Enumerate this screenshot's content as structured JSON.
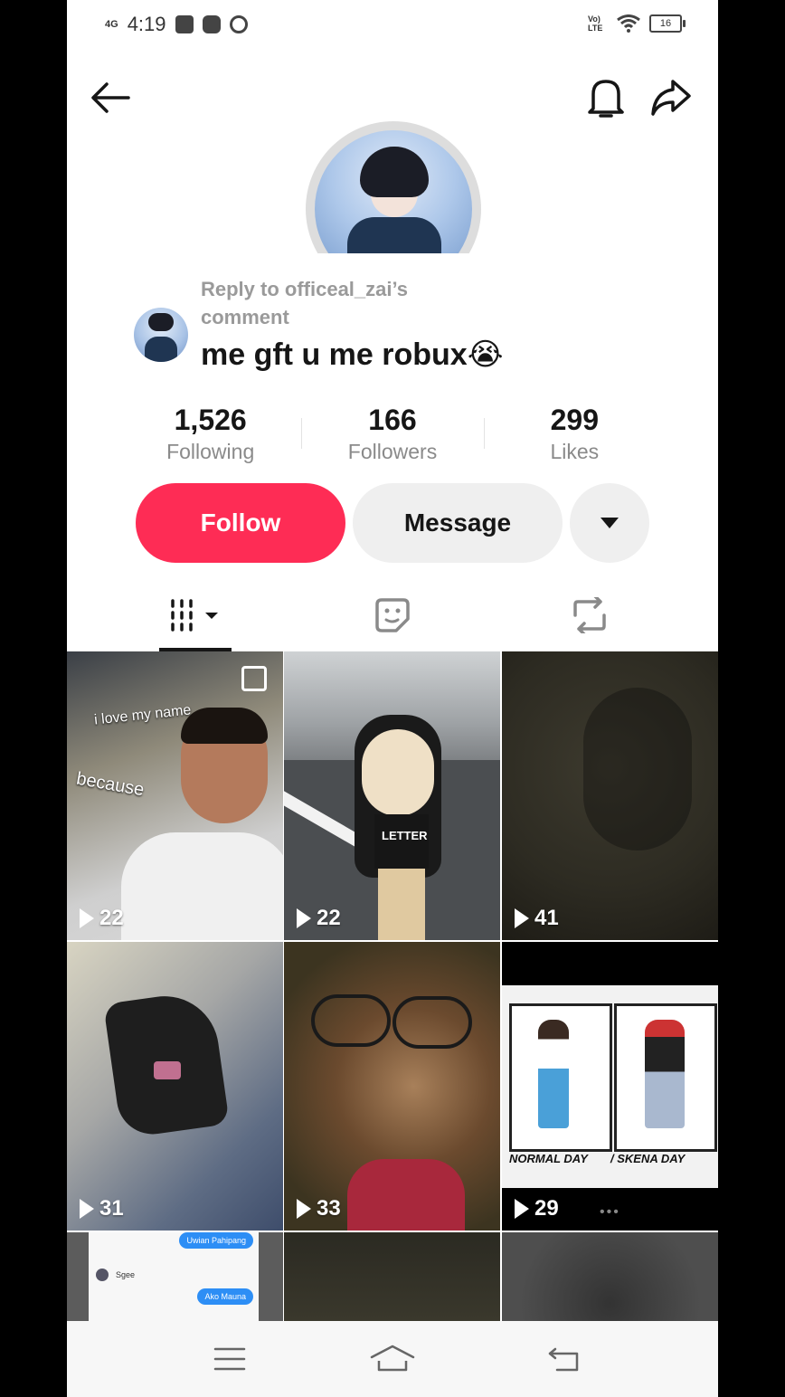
{
  "status_bar": {
    "network": "4G",
    "time": "4:19",
    "lte": "Vo) LTE",
    "battery": "16"
  },
  "header": {
    "back_icon": "arrow-left-icon",
    "bell_icon": "bell-icon",
    "share_icon": "share-arrow-icon"
  },
  "reply": {
    "label": "Reply to officeal_zai’s comment",
    "text": "me gft u me robux😭"
  },
  "stats": [
    {
      "value": "1,526",
      "label": "Following"
    },
    {
      "value": "166",
      "label": "Followers"
    },
    {
      "value": "299",
      "label": "Likes"
    }
  ],
  "actions": {
    "follow": "Follow",
    "message": "Message"
  },
  "tabs": [
    {
      "icon": "videos-grid-icon",
      "selected": true
    },
    {
      "icon": "sticker-icon",
      "selected": false
    },
    {
      "icon": "repost-icon",
      "selected": false
    }
  ],
  "videos": [
    {
      "views": "22",
      "overlay_text_1": "i love my name",
      "overlay_text_2": "because"
    },
    {
      "views": "22",
      "overlay_text_1": "LETTER"
    },
    {
      "views": "41"
    },
    {
      "views": "31"
    },
    {
      "views": "33"
    },
    {
      "views": "29",
      "overlay_text_1": "NORMAL DAY",
      "overlay_text_2": "/ SKENA DAY"
    },
    {
      "chat_1": "Uwian Pahipang",
      "chat_2": "Sgee",
      "chat_3": "Ako Mauna"
    },
    {},
    {}
  ],
  "colors": {
    "accent": "#fe2c55",
    "text": "#161616",
    "muted": "#8a8a8a"
  }
}
